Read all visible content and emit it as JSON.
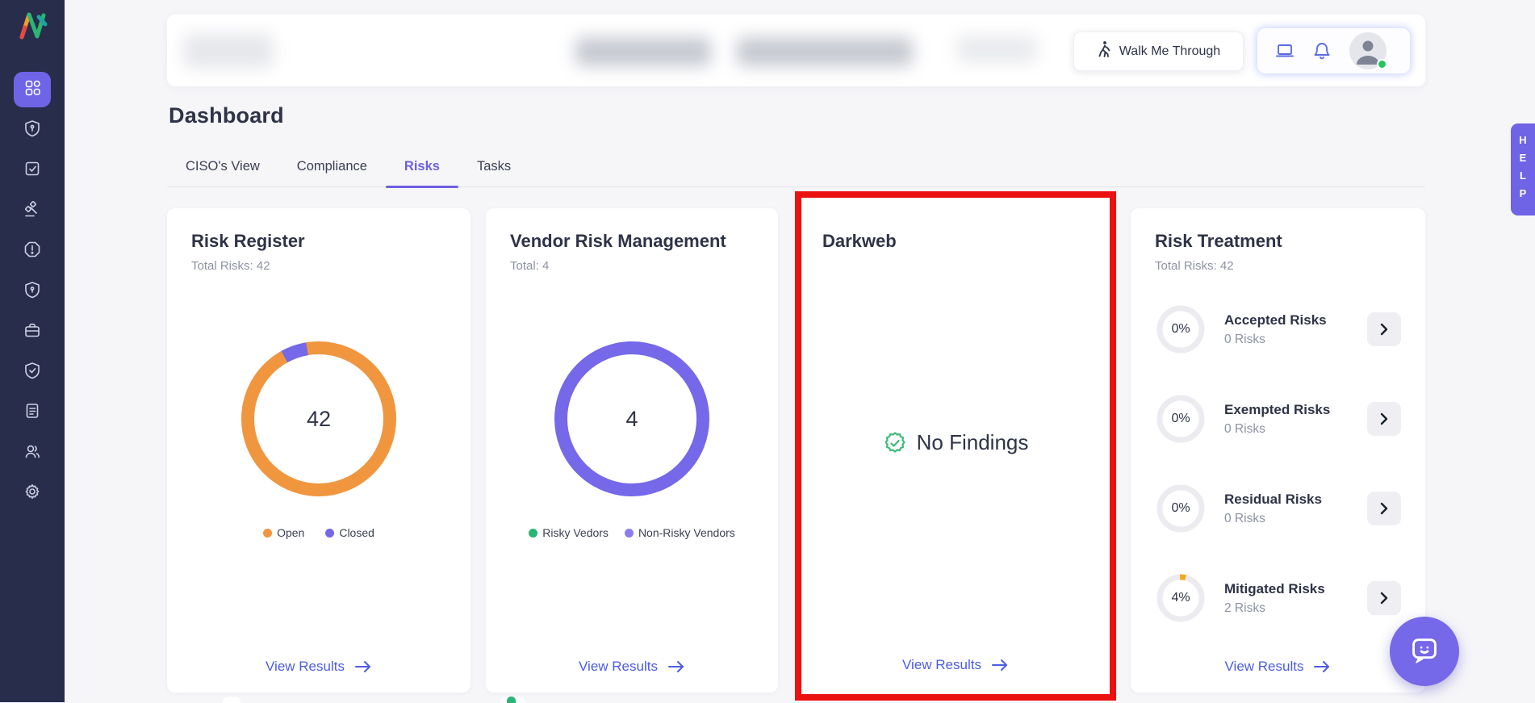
{
  "page": {
    "title": "Dashboard"
  },
  "header": {
    "walk_label": "Walk Me Through",
    "icons": [
      "monitor-icon",
      "bell-icon",
      "avatar"
    ],
    "avatar_status_color": "#22c55e"
  },
  "sidebar": {
    "items": [
      {
        "icon": "dashboard-grid-icon",
        "active": true
      },
      {
        "icon": "shield-key-icon",
        "active": false
      },
      {
        "icon": "task-check-icon",
        "active": false
      },
      {
        "icon": "gavel-icon",
        "active": false
      },
      {
        "icon": "alert-octagon-icon",
        "active": false
      },
      {
        "icon": "shield-lock-icon",
        "active": false
      },
      {
        "icon": "briefcase-icon",
        "active": false
      },
      {
        "icon": "shield-check-icon",
        "active": false
      },
      {
        "icon": "document-icon",
        "active": false
      },
      {
        "icon": "users-icon",
        "active": false
      },
      {
        "icon": "settings-gear-icon",
        "active": false
      }
    ]
  },
  "tabs": {
    "items": [
      {
        "label": "CISO's View",
        "active": false
      },
      {
        "label": "Compliance",
        "active": false
      },
      {
        "label": "Risks",
        "active": true
      },
      {
        "label": "Tasks",
        "active": false
      }
    ]
  },
  "cards": {
    "risk_register": {
      "title": "Risk Register",
      "subtitle": "Total Risks: 42",
      "center_value": "42",
      "chart": {
        "type": "donut",
        "total": 42,
        "segments": [
          {
            "label": "Open",
            "percent": 95,
            "color": "#f0963f"
          },
          {
            "label": "Closed",
            "percent": 5,
            "color": "#7568e9"
          }
        ]
      },
      "legend": [
        {
          "label": "Open",
          "color": "#f0963f"
        },
        {
          "label": "Closed",
          "color": "#7568e9"
        }
      ],
      "view_results": "View Results"
    },
    "vendor": {
      "title": "Vendor Risk Management",
      "subtitle": "Total: 4",
      "center_value": "4",
      "chart": {
        "type": "donut",
        "total": 4,
        "segments": [
          {
            "label": "Risky Vedors",
            "percent": 0,
            "color": "#29b573"
          },
          {
            "label": "Non-Risky Vendors",
            "percent": 100,
            "color": "#7568e9"
          }
        ]
      },
      "legend": [
        {
          "label": "Risky Vedors",
          "color": "#29b573"
        },
        {
          "label": "Non-Risky Vendors",
          "color": "#8d7cf0"
        }
      ],
      "view_results": "View Results"
    },
    "darkweb": {
      "title": "Darkweb",
      "empty_state": "No Findings",
      "highlight_color": "#ec1111",
      "view_results": "View Results"
    },
    "risk_treatment": {
      "title": "Risk Treatment",
      "subtitle": "Total Risks: 42",
      "rows": [
        {
          "percent": "0%",
          "label": "Accepted Risks",
          "count": "0 Risks",
          "arc_percent": 0
        },
        {
          "percent": "0%",
          "label": "Exempted Risks",
          "count": "0 Risks",
          "arc_percent": 0
        },
        {
          "percent": "0%",
          "label": "Residual Risks",
          "count": "0 Risks",
          "arc_percent": 0
        },
        {
          "percent": "4%",
          "label": "Mitigated Risks",
          "count": "2 Risks",
          "arc_percent": 4,
          "arc_color": "#f1a91e"
        }
      ],
      "view_results": "View Results"
    }
  },
  "help": {
    "label": "HELP"
  },
  "colors": {
    "sidebar_bg": "#282d4b",
    "accent_purple": "#6f63e6",
    "link_blue": "#4b5ce4",
    "orange": "#f0963f",
    "green": "#29b573",
    "amber": "#f1a91e",
    "highlight_red": "#ec1111",
    "text_dark": "#2e3347",
    "text_gray": "#8d92a3"
  }
}
